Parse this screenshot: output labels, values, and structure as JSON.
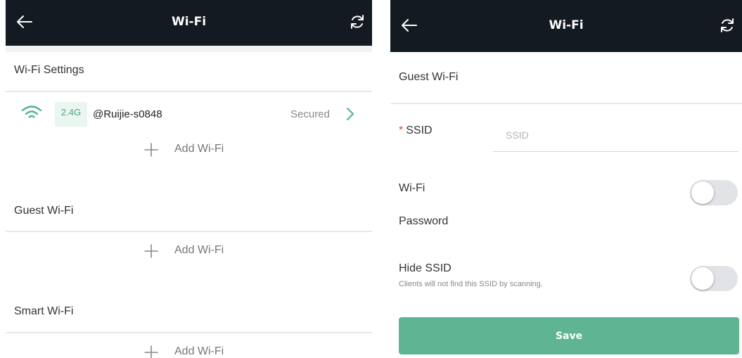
{
  "left_screen": {
    "header": {
      "title": "Wi-Fi",
      "back_icon": "arrow-left-icon",
      "refresh_icon": "refresh-icon"
    },
    "wifi_settings": {
      "title": "Wi-Fi Settings",
      "networks": [
        {
          "band": "2.4G",
          "ssid": "@Ruijie-s0848",
          "status": "Secured",
          "icon": "wifi-icon",
          "chevron_icon": "chevron-right-icon"
        }
      ],
      "add_label": "Add Wi-Fi"
    },
    "guest_wifi": {
      "title": "Guest Wi-Fi",
      "add_label": "Add Wi-Fi"
    },
    "smart_wifi": {
      "title": "Smart Wi-Fi",
      "add_label": "Add Wi-Fi"
    }
  },
  "right_screen": {
    "header": {
      "title": "Wi-Fi",
      "back_icon": "arrow-left-icon",
      "refresh_icon": "refresh-icon"
    },
    "section_title": "Guest Wi-Fi",
    "ssid": {
      "required_mark": "*",
      "label": "SSID",
      "placeholder": "SSID",
      "value": ""
    },
    "wifi_password": {
      "label_line1": "Wi-Fi",
      "label_line2": "Password",
      "enabled": false
    },
    "hide_ssid": {
      "label": "Hide SSID",
      "hint": "Clients will not find this SSID by scanning.",
      "enabled": false
    },
    "save_label": "Save"
  },
  "colors": {
    "header_bg": "#141a22",
    "accent_green": "#5fb592",
    "band_badge_bg": "#eaf6f0",
    "band_badge_text": "#4aa57c",
    "required_red": "#e84a3d"
  }
}
